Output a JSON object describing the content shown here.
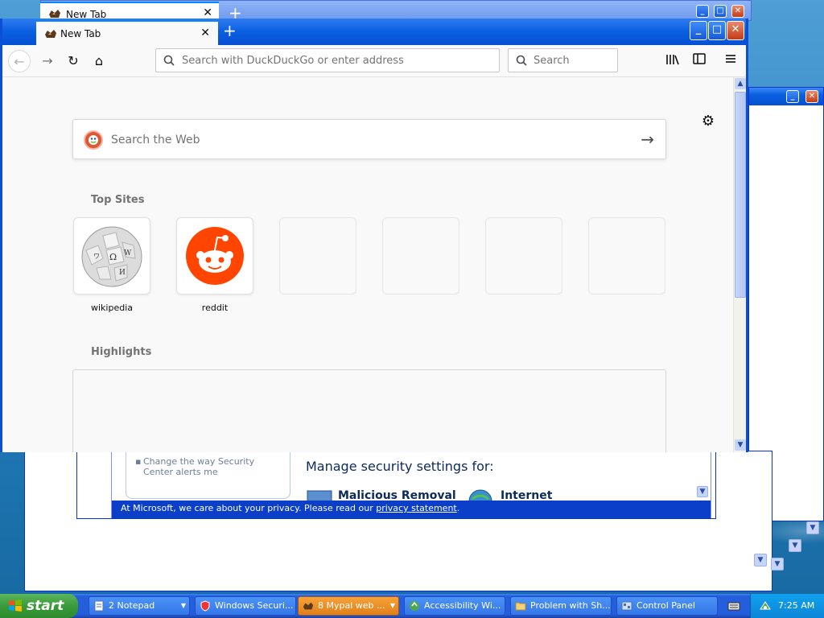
{
  "browser": {
    "tab_title": "New Tab",
    "back_tab_title": "New Tab",
    "address_placeholder": "Search with DuckDuckGo or enter address",
    "search_placeholder": "Search",
    "content_search_placeholder": "Search the Web",
    "top_sites_title": "Top Sites",
    "highlights_title": "Highlights",
    "top_sites": [
      {
        "label": "wikipedia"
      },
      {
        "label": "reddit"
      }
    ]
  },
  "security_center": {
    "side_link": "Change the way Security Center alerts me",
    "heading": "Manage security settings for:",
    "item_1": "Malicious Removal Tool",
    "item_2": "Internet Options",
    "footer_text": "At Microsoft, we care about your privacy.  Please read our ",
    "footer_link": "privacy statement",
    "footer_end": "."
  },
  "taskbar": {
    "start_label": "start",
    "items": [
      {
        "label": "2 Notepad"
      },
      {
        "label": "Windows Securi..."
      },
      {
        "label": "8 Mypal web ..."
      },
      {
        "label": "Accessibility Wi..."
      },
      {
        "label": "Problem with Sh..."
      },
      {
        "label": "Control Panel"
      }
    ],
    "clock": "7:25 AM"
  },
  "colors": {
    "ddg": "#de5833",
    "reddit": "#ff4500",
    "xp_blue": "#0a4fd6",
    "taskbar_active": "#e0801a"
  }
}
